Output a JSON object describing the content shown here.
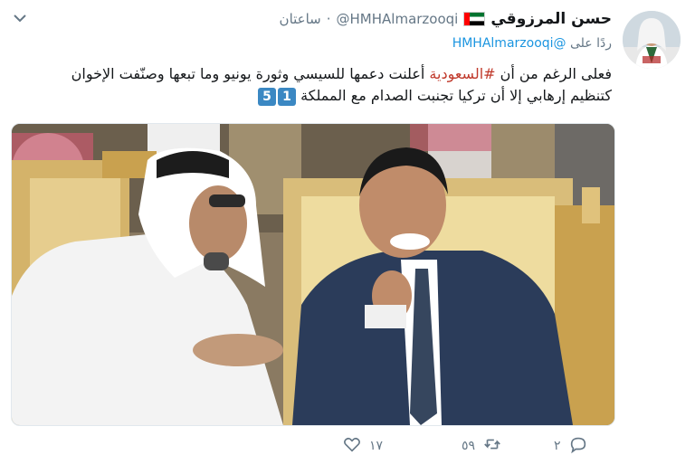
{
  "tweet": {
    "author_name": "حسن المرزوقي",
    "handle": "@HMHAlmarzooqi",
    "dot": "·",
    "time": "ساعتان",
    "reply_prefix": "ردًا على",
    "reply_to": "@HMHAlmarzooqi",
    "text_part1": "فعلى الرغم من أن ",
    "hashtag": "#السعودية",
    "text_part2": " أعلنت دعمها للسيسي وثورة يونيو وما تبعها وصنّفت الإخوان كتنظيم إرهابي إلا أن تركيا تجنبت الصدام مع المملكة",
    "badge_1": "1",
    "badge_2": "5"
  },
  "actions": {
    "reply_count": "٢",
    "retweet_count": "٥٩",
    "like_count": "١٧"
  },
  "icons": {
    "avatar": "avatar",
    "flag": "uae-flag-icon",
    "menu": "chevron-down-icon",
    "reply": "reply-icon",
    "retweet": "retweet-icon",
    "like": "heart-icon"
  },
  "colors": {
    "mention": "#1b95e0",
    "hashtag": "#c0392b",
    "meta": "#657786",
    "badge": "#3b88c3"
  }
}
